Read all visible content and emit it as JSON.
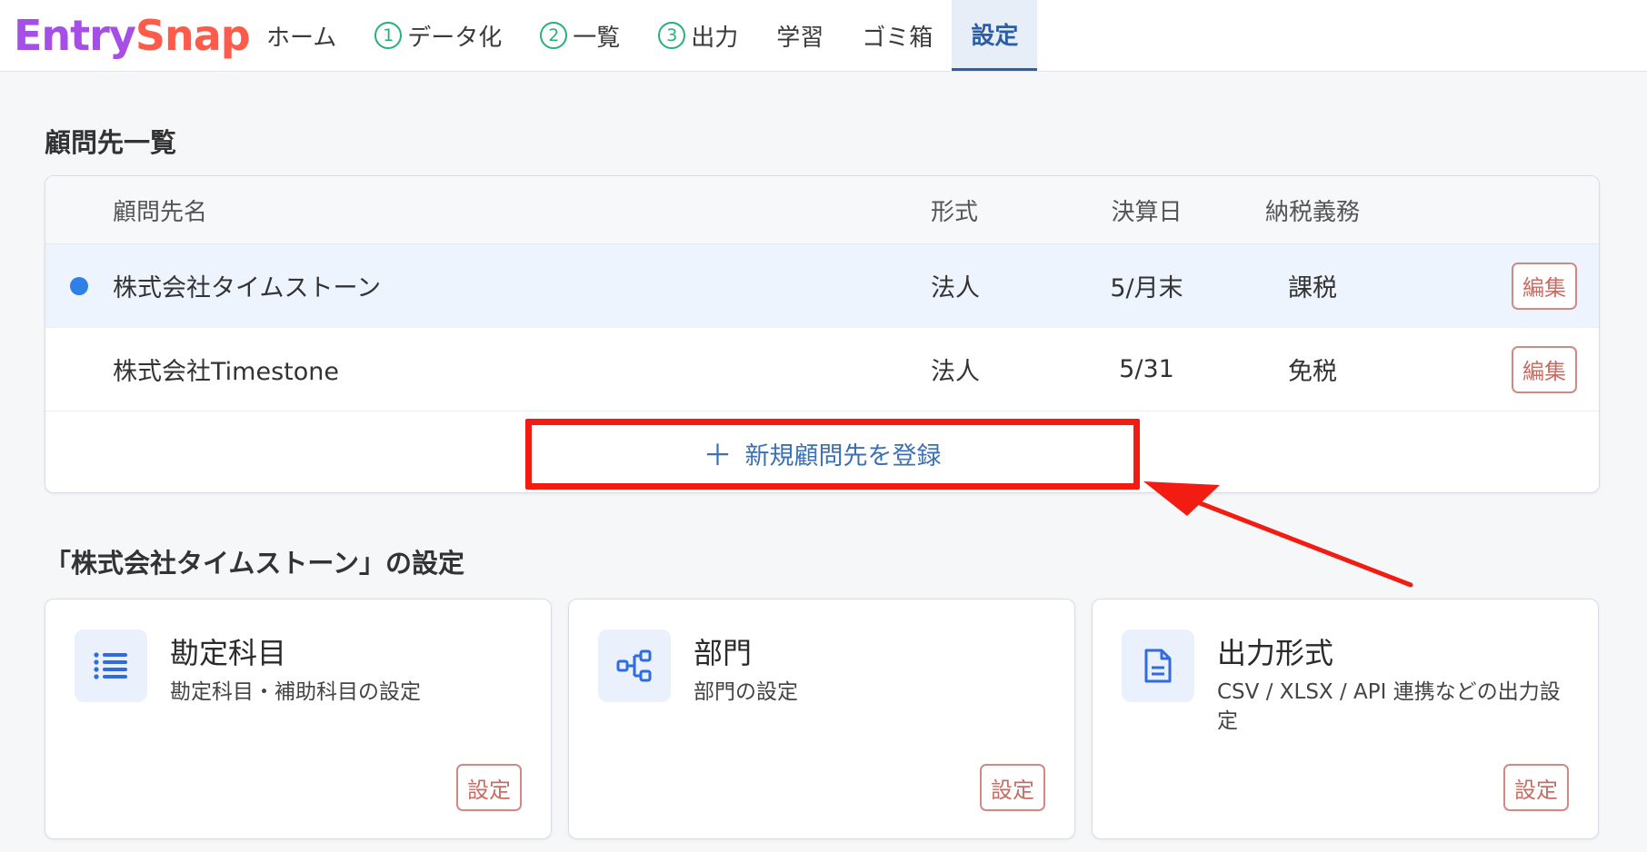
{
  "brand": {
    "name_part1": "Entry",
    "name_part2": "Snap"
  },
  "nav": {
    "home": "ホーム",
    "step1_num": "1",
    "step1_label": "データ化",
    "step2_num": "2",
    "step2_label": "一覧",
    "step3_num": "3",
    "step3_label": "出力",
    "learning": "学習",
    "trash": "ゴミ箱",
    "settings": "設定",
    "active": "settings"
  },
  "clients": {
    "title": "顧問先一覧",
    "columns": {
      "name": "顧問先名",
      "type": "形式",
      "closing": "決算日",
      "tax": "納税義務"
    },
    "rows": [
      {
        "selected": true,
        "name": "株式会社タイムストーン",
        "type": "法人",
        "closing": "5/月末",
        "tax": "課税",
        "edit": "編集"
      },
      {
        "selected": false,
        "name": "株式会社Timestone",
        "type": "法人",
        "closing": "5/31",
        "tax": "免税",
        "edit": "編集"
      }
    ],
    "add_plus": "＋",
    "add_label": "新規顧問先を登録"
  },
  "settings": {
    "title": "「株式会社タイムストーン」の設定",
    "cards": [
      {
        "icon": "list-icon",
        "title": "勘定科目",
        "desc": "勘定科目・補助科目の設定",
        "button": "設定"
      },
      {
        "icon": "org-chart-icon",
        "title": "部門",
        "desc": "部門の設定",
        "button": "設定"
      },
      {
        "icon": "document-icon",
        "title": "出力形式",
        "desc": "CSV / XLSX / API 連携などの出力設定",
        "button": "設定"
      }
    ]
  },
  "colors": {
    "accent": "#2b5ea6",
    "step_green": "#26b07a",
    "selected_dot": "#2f7fe8",
    "edit_red": "#c96c64",
    "annotation_red": "#f21c12"
  }
}
